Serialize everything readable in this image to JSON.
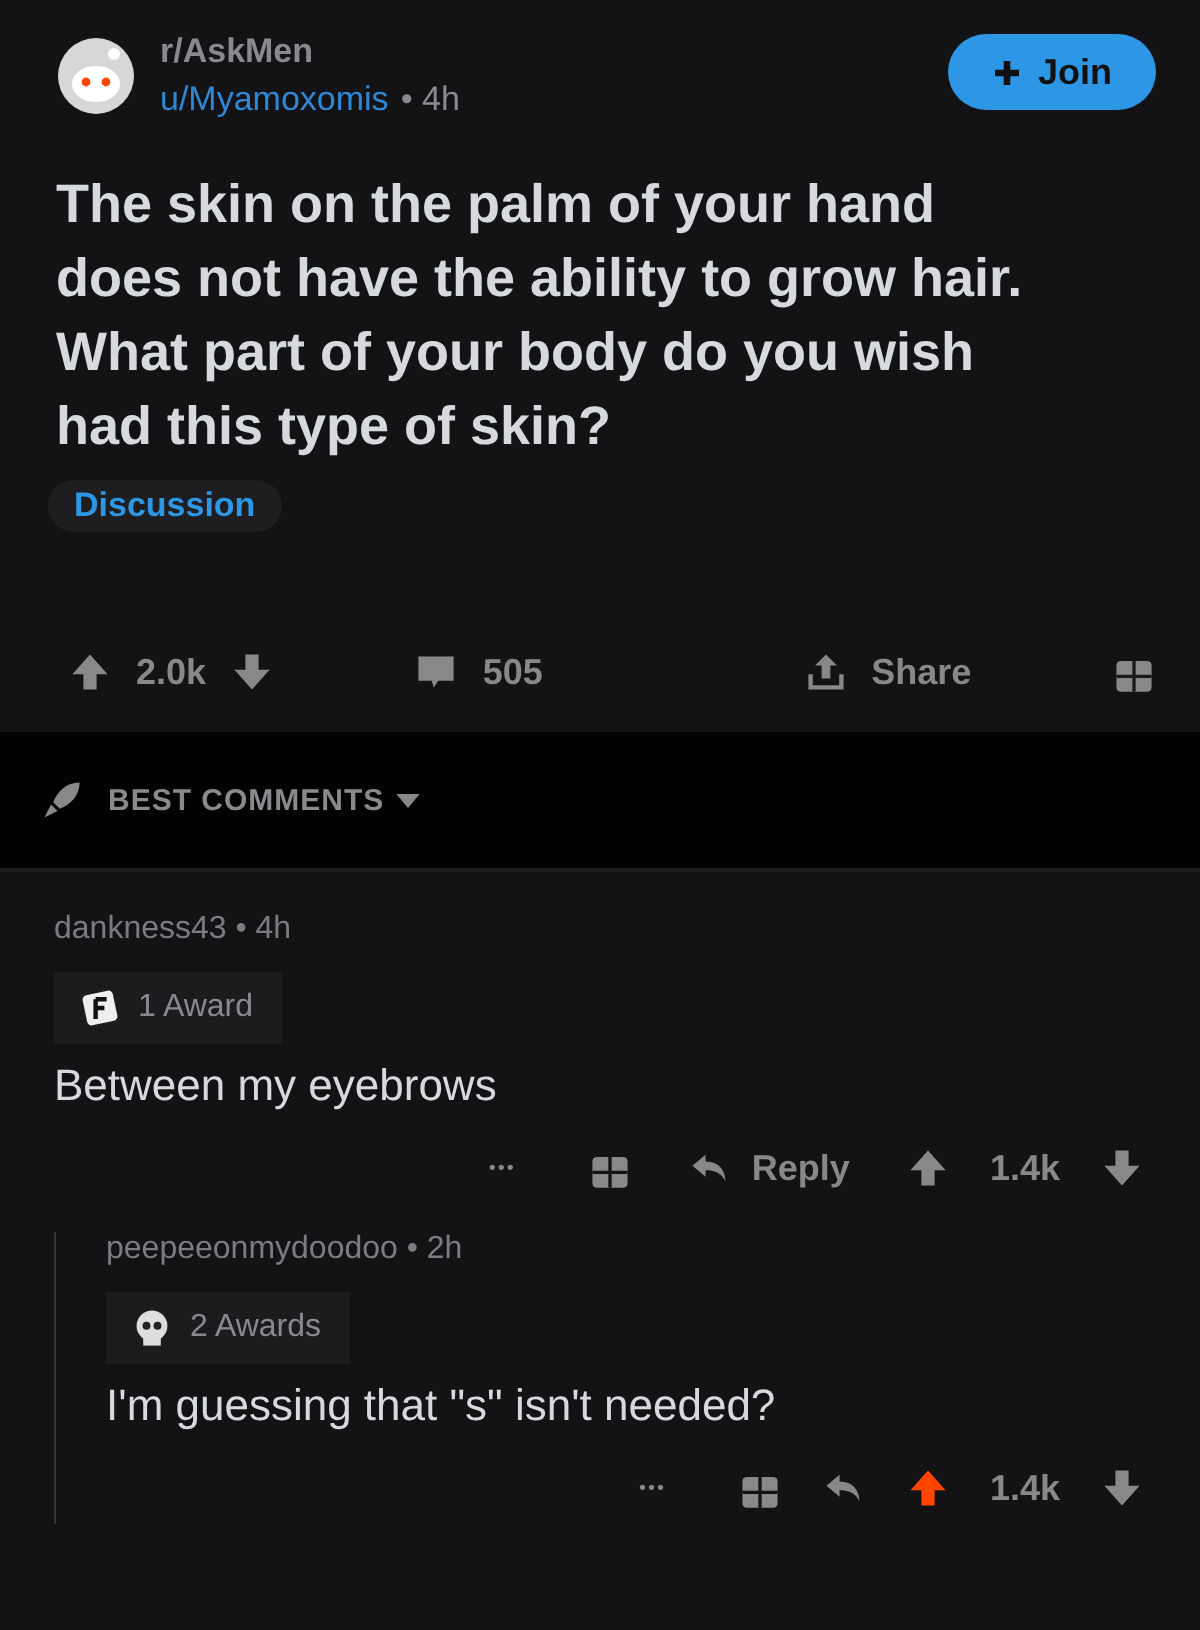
{
  "post": {
    "subreddit": "r/AskMen",
    "author": "u/Myamoxomis",
    "age": "• 4h",
    "join_label": "Join",
    "title": "The skin on the palm of your hand does not have the ability to grow hair. What part of your body do you wish had this type of skin?",
    "flair": "Discussion"
  },
  "actions": {
    "score": "2.0k",
    "comments": "505",
    "share": "Share"
  },
  "sort": {
    "label": "BEST COMMENTS"
  },
  "comments": [
    {
      "author": "dankness43",
      "age": "• 4h",
      "awards": "1 Award",
      "kind": "letter",
      "body": "Between my eyebrows",
      "more": "•••",
      "reply": "Reply",
      "score": "1.4k",
      "upvoted": false,
      "nested": false
    },
    {
      "author": "peepeeonmydoodoo",
      "age": "• 2h",
      "awards": "2 Awards",
      "kind": "skull",
      "body": "I'm guessing that \"s\" isn't needed?",
      "more": "•••",
      "score": "1.4k",
      "upvoted": true,
      "nested": true
    }
  ]
}
